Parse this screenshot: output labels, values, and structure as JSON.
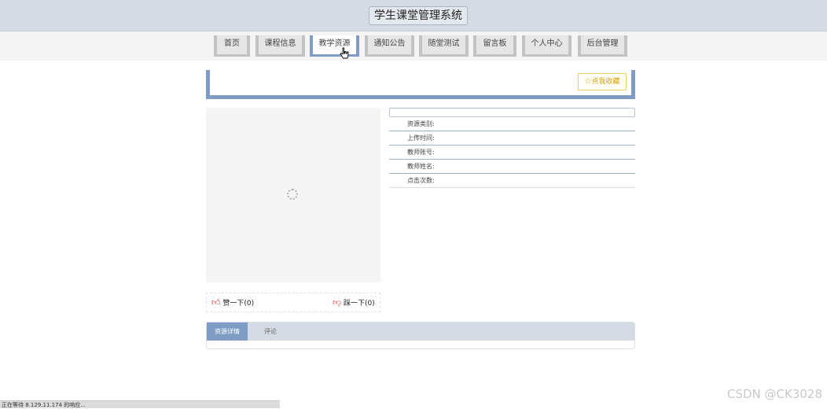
{
  "header": {
    "title": "学生课堂管理系统"
  },
  "nav": {
    "items": [
      {
        "label": "首页"
      },
      {
        "label": "课程信息"
      },
      {
        "label": "教学资源"
      },
      {
        "label": "通知公告"
      },
      {
        "label": "随堂测试"
      },
      {
        "label": "留言板"
      },
      {
        "label": "个人中心"
      },
      {
        "label": "后台管理"
      }
    ],
    "active": "教学资源"
  },
  "detail": {
    "favorite_label": "点我收藏",
    "fields": [
      {
        "label": "资源类别:",
        "value": ""
      },
      {
        "label": "上传时间:",
        "value": ""
      },
      {
        "label": "教师账号:",
        "value": ""
      },
      {
        "label": "教师姓名:",
        "value": ""
      },
      {
        "label": "点击次数:",
        "value": ""
      }
    ],
    "like_label": "赞一下(0)",
    "dislike_label": "踩一下(0)"
  },
  "tabs": [
    {
      "label": "资源详情"
    },
    {
      "label": "评论"
    }
  ],
  "status_bar": {
    "text": "正在等待 8.129.11.174 的响应..."
  },
  "watermark": "CSDN @CK3028",
  "colors": {
    "accent": "#7e9cc4",
    "header_bg": "#d5dbe5",
    "favorite": "#d8a400"
  }
}
